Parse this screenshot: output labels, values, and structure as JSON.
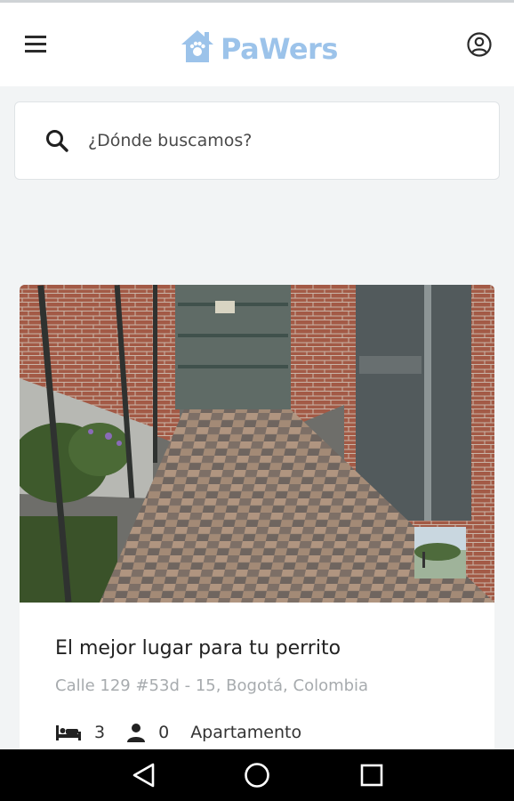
{
  "app": {
    "logo_text": "PaWers",
    "brand_color": "#9cc3ea"
  },
  "header": {
    "menu_icon": "hamburger-menu-icon",
    "profile_icon": "user-circle-icon"
  },
  "search": {
    "placeholder": "¿Dónde buscamos?",
    "icon": "search-icon"
  },
  "listing": {
    "title": "El mejor lugar para tu perrito",
    "address": "Calle 129 #53d - 15, Bogotá, Colombia",
    "beds": "3",
    "guests": "0",
    "type": "Apartamento"
  },
  "navbar": {
    "icons": [
      "back-triangle-icon",
      "home-circle-icon",
      "recents-square-icon"
    ]
  }
}
